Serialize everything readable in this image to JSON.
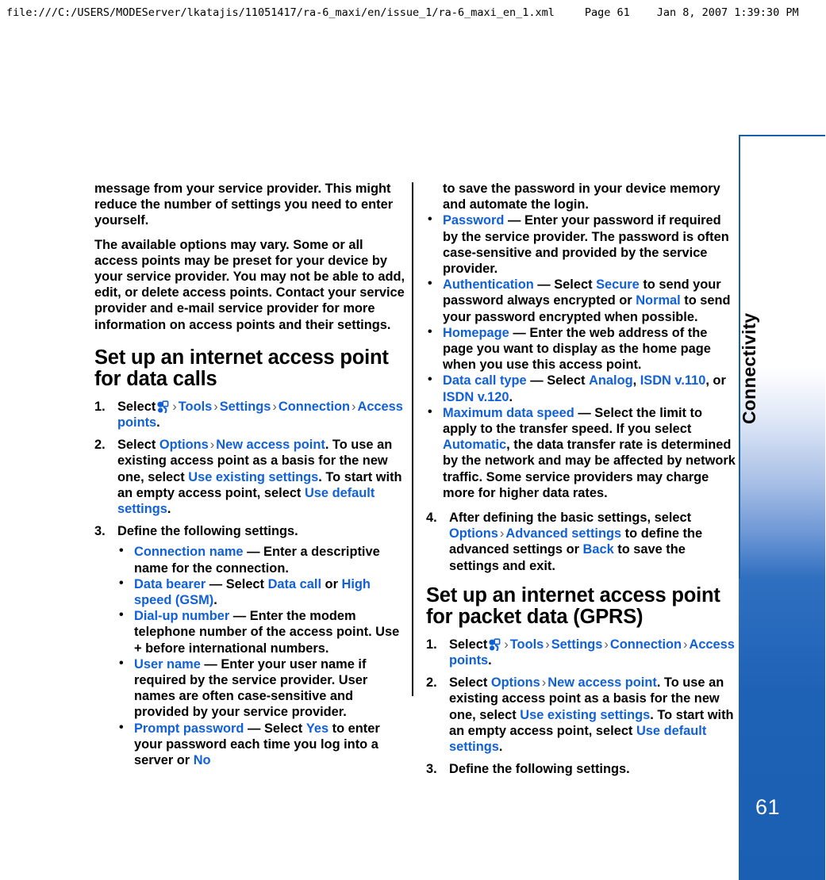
{
  "print_header": {
    "path": "file:///C:/USERS/MODEServer/lkatajis/11051417/ra-6_maxi/en/issue_1/ra-6_maxi_en_1.xml",
    "page_label": "Page 61",
    "timestamp": "Jan 8, 2007 1:39:30 PM"
  },
  "sidebar": {
    "chapter_label": "Connectivity",
    "page_number": "61",
    "border_color": "#1a5fa8",
    "gradient_end_color": "#1a5fb2",
    "page_number_color": "#ffffff"
  },
  "theme": {
    "link_color": "#1060d8",
    "text_color": "#000000",
    "arrow_color": "#5f5f5f"
  },
  "left_column": {
    "paragraph_continued": "message from your service provider. This might reduce the number of settings you need to enter yourself.",
    "paragraph_2": "The available options may vary. Some or all access points may be preset for your device by your service provider. You may not be able to add, edit, or delete access points. Contact your service provider and e-mail service provider for more information on access points and their settings.",
    "heading": "Set up an internet access point for data calls",
    "step1": {
      "num": "1.",
      "lead": "Select",
      "icon": "nokia-menu-icon",
      "arrow": "›",
      "path": [
        "Tools",
        "Settings",
        "Connection",
        "Access points"
      ],
      "trailing": "."
    },
    "step2": {
      "num": "2.",
      "t1": "Select ",
      "l1": "Options",
      "arrow": "›",
      "l2": "New access point",
      "t2": ". To use an existing access point as a basis for the new one, select ",
      "l3": "Use existing settings",
      "t3": ". To start with an empty access point, select ",
      "l4": "Use default settings",
      "t4": "."
    },
    "step3": {
      "num": "3.",
      "text": "Define the following settings.",
      "bullets": [
        {
          "term": "Connection name",
          "dash": "—",
          "body": "Enter a descriptive name for the connection."
        },
        {
          "term": "Data bearer",
          "dash": "—",
          "body_pre": "Select ",
          "opt1": "Data call",
          "body_mid": " or ",
          "opt2": "High speed (GSM)",
          "body_post": "."
        },
        {
          "term": "Dial-up number",
          "dash": "—",
          "body": "Enter the modem telephone number of the access point. Use + before international numbers."
        },
        {
          "term": "User name",
          "dash": "—",
          "body": "Enter your user name if required by the service provider. User names are often case-sensitive and provided by your service provider."
        },
        {
          "term": "Prompt password",
          "dash": "—",
          "body_pre": "Select ",
          "opt1": "Yes",
          "body_mid": " to enter your password each time you log into a server or ",
          "opt2": "No",
          "body_post": ""
        }
      ]
    }
  },
  "right_column": {
    "continued_bullet_text": "to save the password in your device memory and automate the login.",
    "bullets": [
      {
        "term": "Password",
        "dash": "—",
        "body": "Enter your password if required by the service provider. The password is often case-sensitive and provided by the service provider."
      },
      {
        "term": "Authentication",
        "dash": "—",
        "body_pre": "Select ",
        "opt1": "Secure",
        "body_mid": " to send your password always encrypted or ",
        "opt2": "Normal",
        "body_post": " to send your password encrypted when possible."
      },
      {
        "term": "Homepage",
        "dash": "—",
        "body": "Enter the web address of the page you want to display as the home page when you use this access point."
      },
      {
        "term": "Data call type",
        "dash": "—",
        "body_pre": "Select ",
        "opt1": "Analog",
        "sep1": ", ",
        "opt2": "ISDN v.110",
        "sep2": ", or ",
        "opt3": "ISDN v.120",
        "body_post": "."
      },
      {
        "term": "Maximum data speed",
        "dash": "—",
        "body_pre": "Select the limit to apply to the transfer speed. If you select ",
        "opt1": "Automatic",
        "body_post": ", the data transfer rate is determined by the network and may be affected by network traffic. Some service providers may charge more for higher data rates."
      }
    ],
    "step4": {
      "num": "4.",
      "t1": "After defining the basic settings, select ",
      "l1": "Options",
      "arrow": "›",
      "l2": "Advanced settings",
      "t2": " to define the advanced settings or ",
      "l3": "Back",
      "t3": " to save the settings and exit."
    },
    "heading": "Set up an internet access point for packet data (GPRS)",
    "step1": {
      "num": "1.",
      "lead": "Select",
      "icon": "nokia-menu-icon",
      "arrow": "›",
      "path": [
        "Tools",
        "Settings",
        "Connection",
        "Access points"
      ],
      "trailing": "."
    },
    "step2": {
      "num": "2.",
      "t1": "Select ",
      "l1": "Options",
      "arrow": "›",
      "l2": "New access point",
      "t2": ". To use an existing access point as a basis for the new one, select ",
      "l3": "Use existing settings",
      "t3": ". To start with an empty access point, select ",
      "l4": "Use default settings",
      "t4": "."
    },
    "step3": {
      "num": "3.",
      "text": "Define the following settings."
    }
  }
}
